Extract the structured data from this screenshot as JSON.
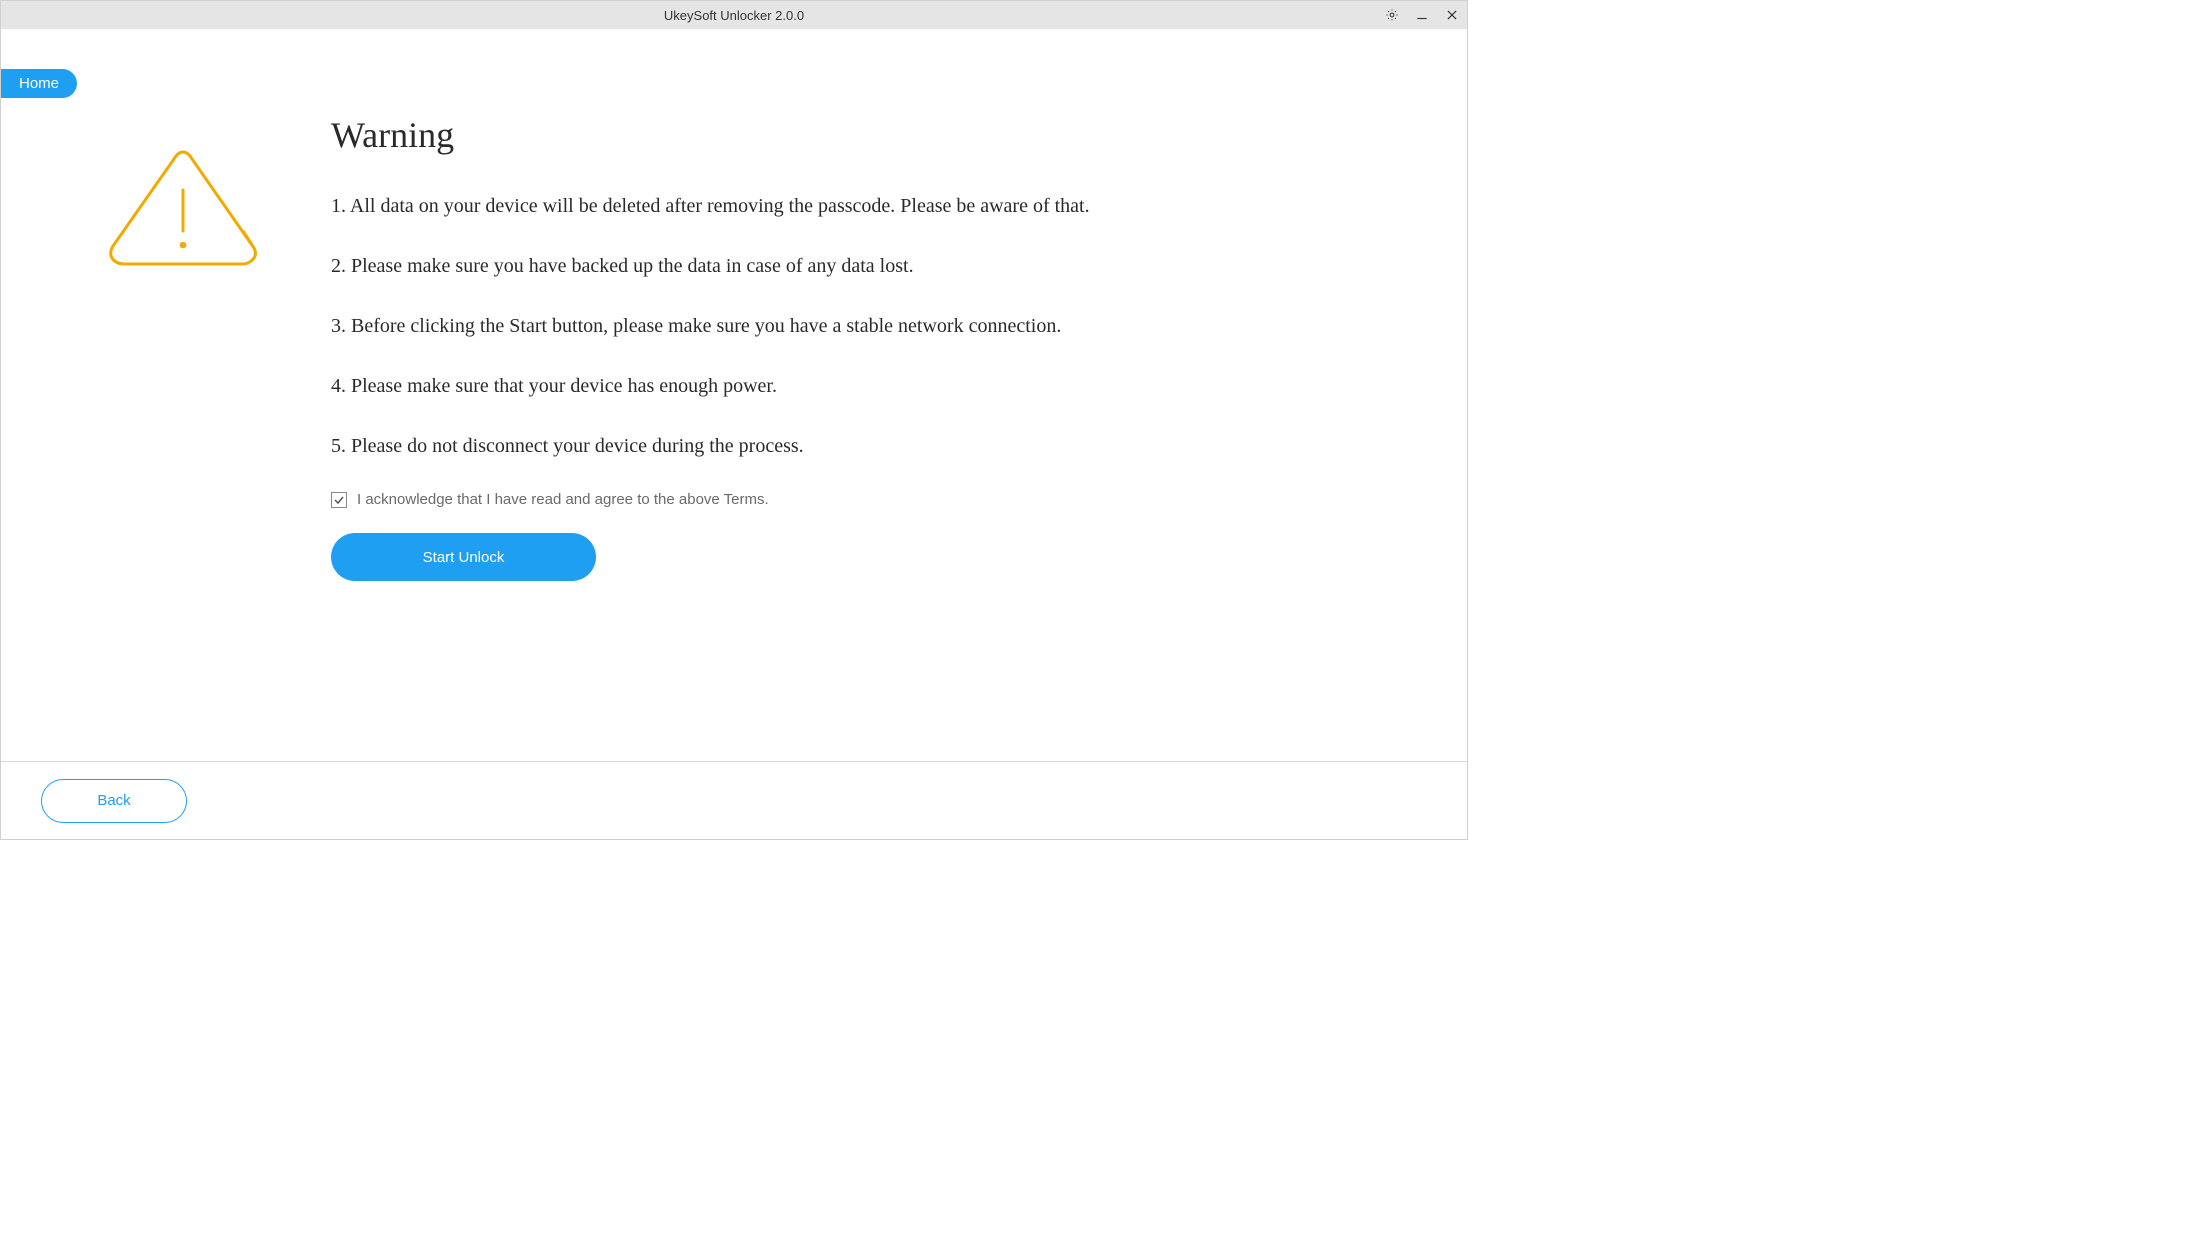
{
  "title": "UkeySoft Unlocker 2.0.0",
  "nav": {
    "home_label": "Home"
  },
  "warning": {
    "heading": "Warning",
    "items": [
      "1. All data on your device will be deleted after removing the passcode. Please be aware of that.",
      "2. Please make sure you have backed up the data in case of any data lost.",
      "3. Before clicking the Start button, please make sure you have a stable network connection.",
      "4. Please make sure that your device has enough power.",
      "5. Please do not disconnect your device during the process."
    ],
    "ack_label": "I acknowledge that I have read and agree to the above Terms.",
    "ack_checked": true
  },
  "buttons": {
    "start_label": "Start Unlock",
    "back_label": "Back"
  },
  "colors": {
    "accent": "#1e9ff2",
    "warning_icon": "#f2a900"
  }
}
